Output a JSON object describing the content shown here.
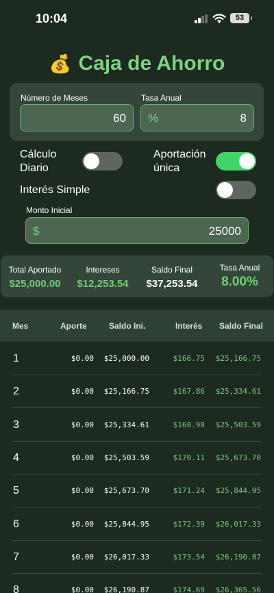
{
  "status_bar": {
    "time": "10:04",
    "battery": "53"
  },
  "header": {
    "icon": "💰",
    "title": "Caja de Ahorro"
  },
  "inputs": {
    "meses_label": "Número de Meses",
    "meses_value": "60",
    "tasa_label": "Tasa Anual",
    "tasa_prefix": "%",
    "tasa_value": "8"
  },
  "toggles": {
    "calculo_diario_label": "Cálculo\nDiario",
    "calculo_diario_on": false,
    "aportacion_unica_label": "Aportación\núnica",
    "aportacion_unica_on": true,
    "interes_simple_label": "Interés Simple",
    "interes_simple_on": false
  },
  "monto": {
    "label": "Monto Inicial",
    "prefix": "$",
    "value": "25000"
  },
  "summary": {
    "total_aportado_label": "Total Aportado",
    "total_aportado_value": "$25,000.00",
    "intereses_label": "Intereses",
    "intereses_value": "$12,253.54",
    "saldo_final_label": "Saldo Final",
    "saldo_final_value": "$37,253.54",
    "tasa_anual_label": "Tasa Anual",
    "tasa_anual_value": "8.00%"
  },
  "table": {
    "headers": [
      "Mes",
      "Aporte",
      "Saldo Ini.",
      "Interés",
      "Saldo Final"
    ],
    "rows": [
      [
        "1",
        "$0.00",
        "$25,000.00",
        "$166.75",
        "$25,166.75"
      ],
      [
        "2",
        "$0.00",
        "$25,166.75",
        "$167.86",
        "$25,334.61"
      ],
      [
        "3",
        "$0.00",
        "$25,334.61",
        "$168.98",
        "$25,503.59"
      ],
      [
        "4",
        "$0.00",
        "$25,503.59",
        "$170.11",
        "$25,673.70"
      ],
      [
        "5",
        "$0.00",
        "$25,673.70",
        "$171.24",
        "$25,844.95"
      ],
      [
        "6",
        "$0.00",
        "$25,844.95",
        "$172.39",
        "$26,017.33"
      ],
      [
        "7",
        "$0.00",
        "$26,017.33",
        "$173.54",
        "$26,190.87"
      ],
      [
        "8",
        "$0.00",
        "$26,190.87",
        "$174.69",
        "$26,365.56"
      ]
    ]
  },
  "colors": {
    "background": "#1c2a1f",
    "accent_green": "#7fd184",
    "toggle_on": "#3fd36a"
  }
}
